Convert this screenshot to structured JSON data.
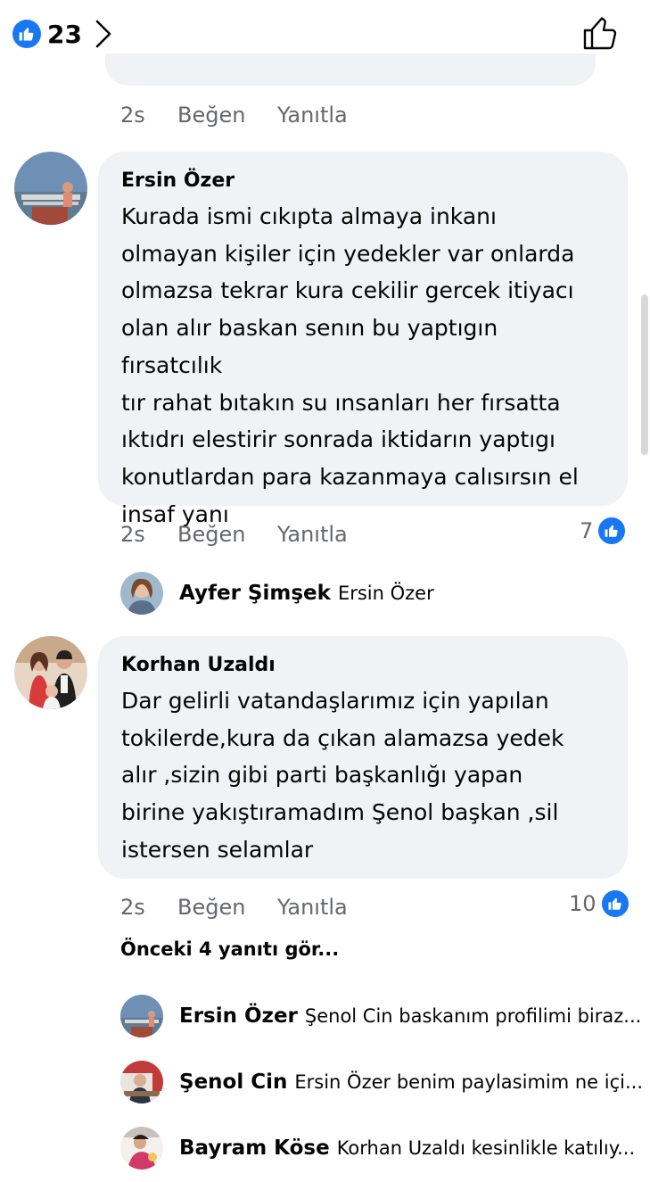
{
  "top": {
    "reaction_count": "23",
    "colors": {
      "accent": "#1877f2"
    },
    "icons": {
      "like_badge": "thumbs-up-icon",
      "chevron": "chevron-right-icon",
      "like_button": "thumbs-up-outline-icon"
    }
  },
  "prev_comment_actions": {
    "time": "2s",
    "like": "Beğen",
    "reply": "Yanıtla"
  },
  "comments": [
    {
      "author": "Ersin Özer",
      "lines": [
        "Kurada ismi cıkıpta almaya inkanı",
        "olmayan kişiler için yedekler var onlarda",
        "olmazsa tekrar kura cekilir gercek itiyacı",
        "olan alır baskan senın bu yaptıgın fırsatcılık",
        "tır rahat bıtakın su ınsanları her fırsatta",
        "ıktıdrı elestirir sonrada iktidarın yaptıgı",
        "konutlardan para kazanmaya calısırsın el",
        "insaf yanı"
      ],
      "time": "2s",
      "like": "Beğen",
      "reply": "Yanıtla",
      "reaction_count": "7",
      "reply_preview": {
        "name": "Ayfer Şimşek",
        "text": "Ersin Özer"
      }
    },
    {
      "author": "Korhan Uzaldı",
      "lines": [
        "Dar gelirli vatandaşlarımız için yapılan",
        "tokilerde,kura da çıkan alamazsa yedek",
        "alır ,sizin gibi parti başkanlığı yapan",
        "birine yakıştıramadım Şenol başkan ,sil",
        "istersen selamlar"
      ],
      "time": "2s",
      "like": "Beğen",
      "reply": "Yanıtla",
      "reaction_count": "10",
      "view_previous": "Önceki 4 yanıtı gör...",
      "replies": [
        {
          "name": "Ersin Özer",
          "text": "Şenol Cin baskanım profilimi biraz..."
        },
        {
          "name": "Şenol Cin",
          "text": "Ersin Özer benim paylasimim ne içi..."
        },
        {
          "name": "Bayram Köse",
          "text": "Korhan Uzaldı kesinlikle katılıy..."
        }
      ]
    }
  ]
}
